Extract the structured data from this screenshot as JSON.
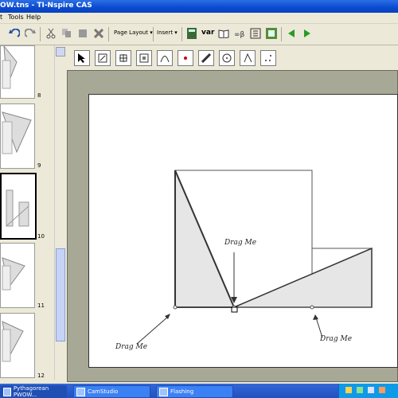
{
  "window": {
    "title": "OW.tns - TI-Nspire CAS"
  },
  "menu": {
    "items": [
      "t",
      "Tools",
      "Help"
    ]
  },
  "toolbar": {
    "page_layout_label": "Page Layout",
    "insert_label": "Insert",
    "var_label": "var"
  },
  "sidebar": {
    "pages": [
      {
        "number": "8"
      },
      {
        "number": "9"
      },
      {
        "number": "10"
      },
      {
        "number": "11"
      },
      {
        "number": "12"
      }
    ]
  },
  "canvas": {
    "labels": {
      "drag_top": "Drag Me",
      "drag_left": "Drag Me",
      "drag_right": "Drag Me"
    }
  },
  "taskbar": {
    "tasks": [
      "Pythagorean PWOW...",
      "CamStudio",
      "Flashing"
    ]
  },
  "colors": {
    "titlebar": "#0a4ad0",
    "taskbar": "#2450c0",
    "workspace": "#a8a896",
    "triangle_fill": "#e6e6e6"
  }
}
